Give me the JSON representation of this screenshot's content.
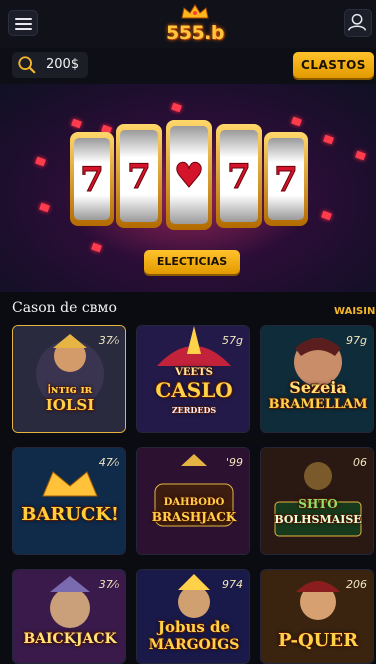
{
  "header": {
    "logo_text": "555.b"
  },
  "balance": {
    "amount": "200$"
  },
  "actions": {
    "claim_label": "CLASTOS"
  },
  "hero": {
    "button_label": "ELECTICIAS",
    "reels": [
      "7",
      "7",
      "♥",
      "7",
      "7"
    ]
  },
  "section": {
    "title": "Cason de cвмo",
    "see_all": "WAISIN"
  },
  "games": [
    {
      "pct": "37⁄₀",
      "title_lines": [
        "𝗂ɴᴛɪɢ ɪʀ",
        "IOLSI"
      ]
    },
    {
      "pct": "57g",
      "title_lines": [
        "VEETS",
        "CASLO",
        "ZERDEDS"
      ]
    },
    {
      "pct": "97g",
      "title_lines": [
        "Sezeia",
        "BRAMELLAM"
      ]
    },
    {
      "pct": "47⁄₀",
      "title_lines": [
        "BARUCK!"
      ]
    },
    {
      "pct": "'99",
      "title_lines": [
        "DAHBODO",
        "BRASHJACK"
      ]
    },
    {
      "pct": "06",
      "title_lines": [
        "SHTO",
        "BOLHSMAISE"
      ]
    },
    {
      "pct": "37⁄₀",
      "title_lines": [
        "BAICKJACK"
      ]
    },
    {
      "pct": "974",
      "title_lines": [
        "Jobus de",
        "MARGOIGS"
      ]
    },
    {
      "pct": "206",
      "title_lines": [
        "P-QUER"
      ]
    }
  ],
  "colors": {
    "accent": "#f4b52a",
    "background": "#0b0c12",
    "hero": "#2a0d36"
  },
  "icons": [
    "menu-icon",
    "user-icon",
    "search-icon",
    "crown-icon"
  ]
}
